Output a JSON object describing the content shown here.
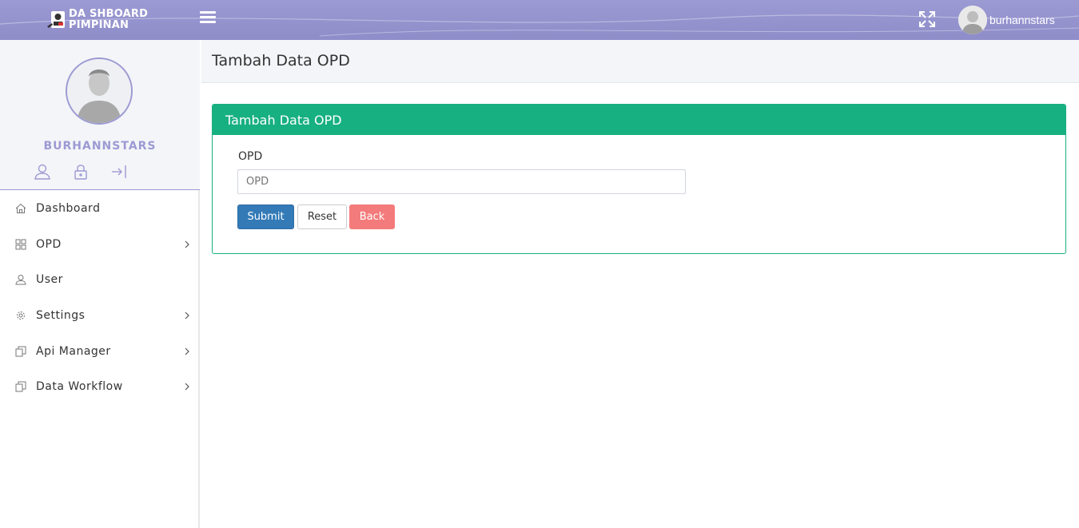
{
  "brand": {
    "line1": "DA SHBOARD",
    "line2": "PIMPINAN"
  },
  "topbar": {
    "username": "burhannstars",
    "menu_icon": "hamburger-icon",
    "expand_icon": "fullscreen-icon"
  },
  "sidebar": {
    "profile_name": "BURHANNSTARS",
    "items": [
      {
        "label": "Dashboard",
        "icon": "home-icon",
        "has_children": false
      },
      {
        "label": "OPD",
        "icon": "grid-icon",
        "has_children": true
      },
      {
        "label": "User",
        "icon": "user-icon",
        "has_children": false
      },
      {
        "label": "Settings",
        "icon": "gear-icon",
        "has_children": true
      },
      {
        "label": "Api Manager",
        "icon": "copy-icon",
        "has_children": true
      },
      {
        "label": "Data Workflow",
        "icon": "copy-icon",
        "has_children": true
      }
    ]
  },
  "page": {
    "title": "Tambah Data OPD"
  },
  "form": {
    "card_title": "Tambah Data OPD",
    "opd_label": "OPD",
    "opd_placeholder": "OPD",
    "opd_value": "",
    "submit_label": "Submit",
    "reset_label": "Reset",
    "back_label": "Back"
  },
  "colors": {
    "accent": "#9c9ad3",
    "card": "#17b080",
    "submit": "#337ab7",
    "back": "#f47b7b"
  }
}
